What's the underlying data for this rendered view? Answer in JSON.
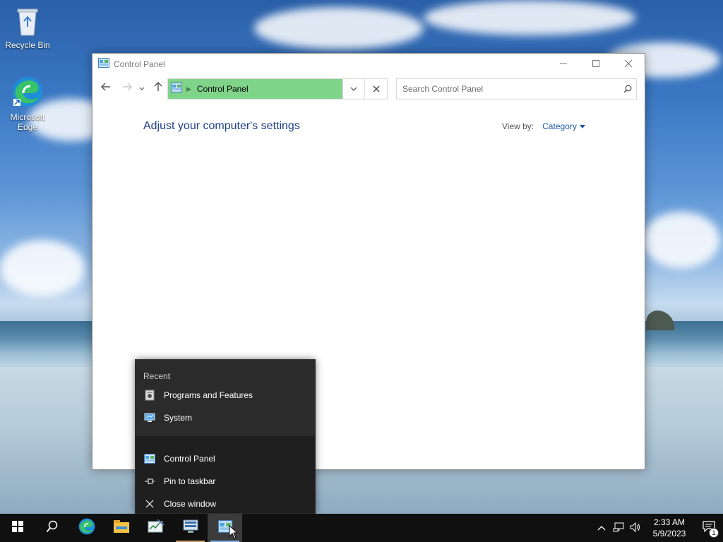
{
  "desktop": {
    "icons": [
      {
        "label": "Recycle Bin",
        "icon": "recycle-bin-icon"
      },
      {
        "label": "Microsoft Edge",
        "icon": "edge-icon"
      }
    ]
  },
  "window": {
    "title": "Control Panel",
    "controls": {
      "minimize": "minimize-icon",
      "maximize": "maximize-icon",
      "close": "close-icon"
    },
    "address": {
      "crumb": "Control Panel"
    },
    "search": {
      "placeholder": "Search Control Panel"
    },
    "heading": "Adjust your computer's settings",
    "view_by": {
      "label": "View by:",
      "value": "Category"
    }
  },
  "jumplist": {
    "recent_heading": "Recent",
    "recent": [
      {
        "label": "Programs and Features",
        "icon": "programs-features-icon"
      },
      {
        "label": "System",
        "icon": "system-icon"
      }
    ],
    "tasks": [
      {
        "label": "Control Panel",
        "icon": "control-panel-icon"
      },
      {
        "label": "Pin to taskbar",
        "icon": "pin-icon"
      },
      {
        "label": "Close window",
        "icon": "close-icon"
      }
    ]
  },
  "taskbar": {
    "apps": [
      "start-icon",
      "search-icon",
      "edge-icon",
      "file-explorer-icon",
      "task-manager-icon",
      "server-manager-icon",
      "control-panel-icon"
    ],
    "clock": {
      "time": "2:33 AM",
      "date": "5/9/2023"
    },
    "notification_count": "1"
  },
  "colors": {
    "crumb_bg": "#7fd48a",
    "heading": "#1e3f8a",
    "link": "#1e5aa8",
    "taskbar": "#101010"
  }
}
